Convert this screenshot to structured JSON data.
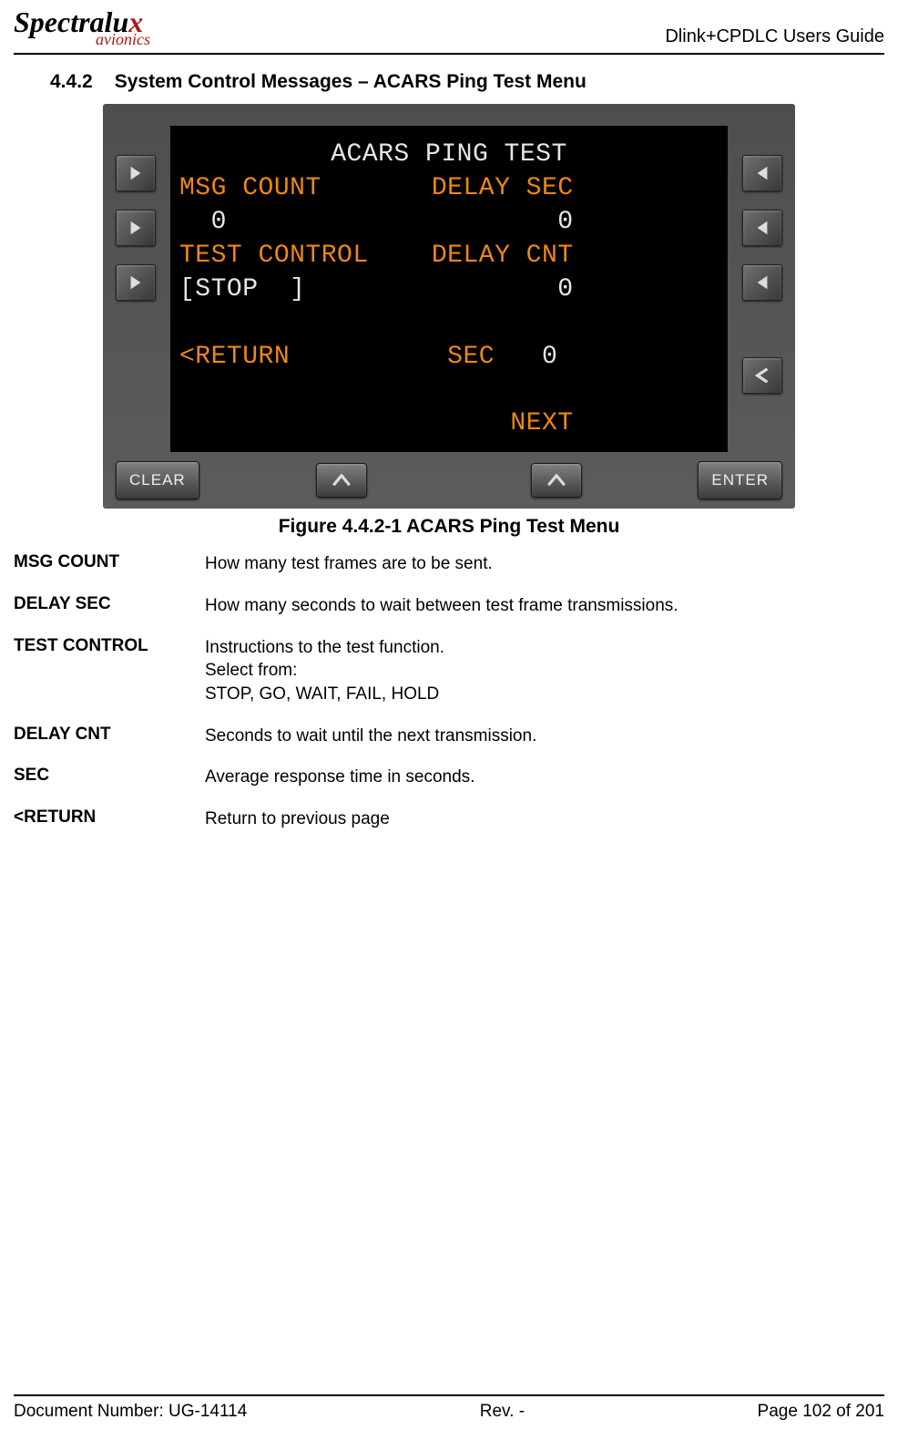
{
  "header": {
    "logo_main": "Spectralu",
    "logo_x": "x",
    "logo_sub": "avionics",
    "doc_title": "Dlink+CPDLC Users Guide"
  },
  "section": {
    "number": "4.4.2",
    "title": "System Control Messages – ACARS Ping Test Menu"
  },
  "screen": {
    "title": "ACARS PING TEST",
    "row2_left": "MSG COUNT",
    "row2_right": "DELAY SEC",
    "row3_left": "  0",
    "row3_right": "0",
    "row4_left": "TEST CONTROL",
    "row4_right": "DELAY CNT",
    "row5_left": "[STOP  ]",
    "row5_right": "0",
    "row6_left": "<RETURN",
    "row6_mid": "SEC",
    "row6_right": "0",
    "row7_right": "NEXT"
  },
  "buttons": {
    "clear": "CLEAR",
    "enter": "ENTER"
  },
  "figure_caption": "Figure 4.4.2-1 ACARS Ping Test Menu",
  "definitions": [
    {
      "term": "MSG COUNT",
      "desc": "How many test frames are to be sent."
    },
    {
      "term": "DELAY SEC",
      "desc": "How many seconds to wait between test frame transmissions."
    },
    {
      "term": "TEST CONTROL",
      "desc": "Instructions to the test function.\nSelect from:\nSTOP, GO, WAIT, FAIL, HOLD"
    },
    {
      "term": "DELAY CNT",
      "desc": "Seconds to wait until the next transmission."
    },
    {
      "term": "SEC",
      "desc": "Average response time in seconds."
    },
    {
      "term": "<RETURN",
      "desc": "Return to previous page"
    }
  ],
  "footer": {
    "left": "Document Number:  UG-14114",
    "mid": "Rev. -",
    "right": "Page 102 of 201"
  }
}
